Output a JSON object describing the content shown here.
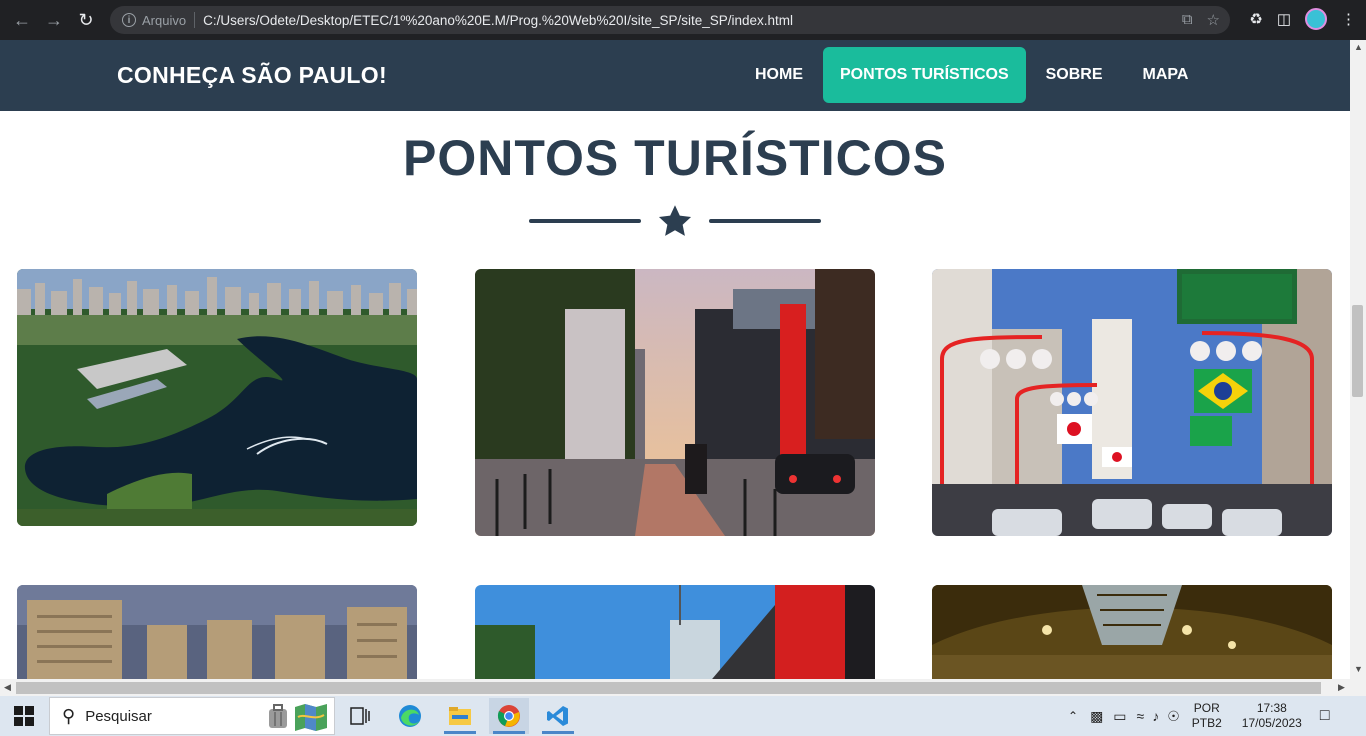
{
  "browser": {
    "info_label": "Arquivo",
    "url": "C:/Users/Odete/Desktop/ETEC/1º%20ano%20E.M/Prog.%20Web%20I/site_SP/site_SP/index.html"
  },
  "site": {
    "brand": "CONHEÇA SÃO PAULO!",
    "menu": [
      {
        "label": "HOME",
        "active": false
      },
      {
        "label": "PONTOS TURÍSTICOS",
        "active": true
      },
      {
        "label": "SOBRE",
        "active": false
      },
      {
        "label": "MAPA",
        "active": false
      }
    ],
    "section_title": "PONTOS TURÍSTICOS",
    "colors": {
      "nav_bg": "#2c3e50",
      "accent": "#1abc9c",
      "title": "#2c3e50"
    },
    "cards": [
      {
        "subject": "Parque Ibirapuera aerial view"
      },
      {
        "subject": "Avenida Paulista with MASP at sunset"
      },
      {
        "subject": "Liberdade street with Japanese lanterns and flags"
      },
      {
        "subject": "Building skyline"
      },
      {
        "subject": "MASP facade"
      },
      {
        "subject": "Mercado Municipal interior"
      }
    ]
  },
  "taskbar": {
    "search_placeholder": "Pesquisar",
    "language": "POR",
    "layout": "PTB2",
    "time": "17:38",
    "date": "17/05/2023"
  }
}
